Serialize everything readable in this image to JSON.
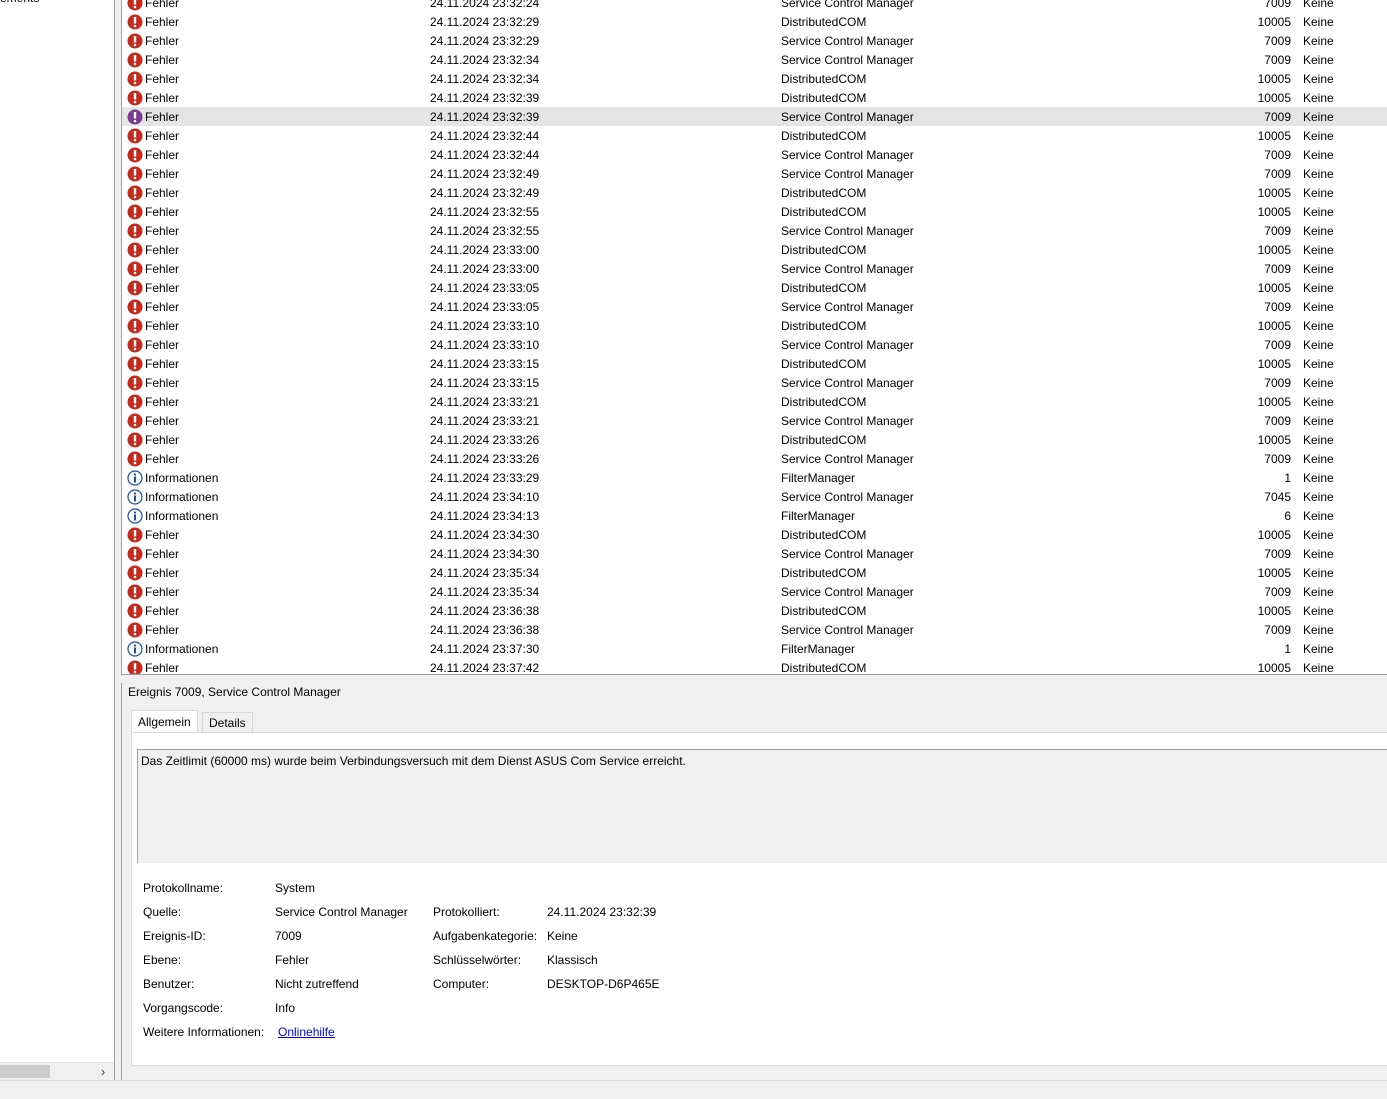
{
  "left_pane": {
    "tree_item_label": "ements"
  },
  "event_list": {
    "rows": [
      {
        "level": "Fehler",
        "type": "error",
        "date": "24.11.2024 23:32:24",
        "source": "Service Control Manager",
        "id": "7009",
        "category": "Keine"
      },
      {
        "level": "Fehler",
        "type": "error",
        "date": "24.11.2024 23:32:29",
        "source": "DistributedCOM",
        "id": "10005",
        "category": "Keine"
      },
      {
        "level": "Fehler",
        "type": "error",
        "date": "24.11.2024 23:32:29",
        "source": "Service Control Manager",
        "id": "7009",
        "category": "Keine"
      },
      {
        "level": "Fehler",
        "type": "error",
        "date": "24.11.2024 23:32:34",
        "source": "Service Control Manager",
        "id": "7009",
        "category": "Keine"
      },
      {
        "level": "Fehler",
        "type": "error",
        "date": "24.11.2024 23:32:34",
        "source": "DistributedCOM",
        "id": "10005",
        "category": "Keine"
      },
      {
        "level": "Fehler",
        "type": "error",
        "date": "24.11.2024 23:32:39",
        "source": "DistributedCOM",
        "id": "10005",
        "category": "Keine"
      },
      {
        "level": "Fehler",
        "type": "error",
        "date": "24.11.2024 23:32:39",
        "source": "Service Control Manager",
        "id": "7009",
        "category": "Keine",
        "selected": true
      },
      {
        "level": "Fehler",
        "type": "error",
        "date": "24.11.2024 23:32:44",
        "source": "DistributedCOM",
        "id": "10005",
        "category": "Keine"
      },
      {
        "level": "Fehler",
        "type": "error",
        "date": "24.11.2024 23:32:44",
        "source": "Service Control Manager",
        "id": "7009",
        "category": "Keine"
      },
      {
        "level": "Fehler",
        "type": "error",
        "date": "24.11.2024 23:32:49",
        "source": "Service Control Manager",
        "id": "7009",
        "category": "Keine"
      },
      {
        "level": "Fehler",
        "type": "error",
        "date": "24.11.2024 23:32:49",
        "source": "DistributedCOM",
        "id": "10005",
        "category": "Keine"
      },
      {
        "level": "Fehler",
        "type": "error",
        "date": "24.11.2024 23:32:55",
        "source": "DistributedCOM",
        "id": "10005",
        "category": "Keine"
      },
      {
        "level": "Fehler",
        "type": "error",
        "date": "24.11.2024 23:32:55",
        "source": "Service Control Manager",
        "id": "7009",
        "category": "Keine"
      },
      {
        "level": "Fehler",
        "type": "error",
        "date": "24.11.2024 23:33:00",
        "source": "DistributedCOM",
        "id": "10005",
        "category": "Keine"
      },
      {
        "level": "Fehler",
        "type": "error",
        "date": "24.11.2024 23:33:00",
        "source": "Service Control Manager",
        "id": "7009",
        "category": "Keine"
      },
      {
        "level": "Fehler",
        "type": "error",
        "date": "24.11.2024 23:33:05",
        "source": "DistributedCOM",
        "id": "10005",
        "category": "Keine"
      },
      {
        "level": "Fehler",
        "type": "error",
        "date": "24.11.2024 23:33:05",
        "source": "Service Control Manager",
        "id": "7009",
        "category": "Keine"
      },
      {
        "level": "Fehler",
        "type": "error",
        "date": "24.11.2024 23:33:10",
        "source": "DistributedCOM",
        "id": "10005",
        "category": "Keine"
      },
      {
        "level": "Fehler",
        "type": "error",
        "date": "24.11.2024 23:33:10",
        "source": "Service Control Manager",
        "id": "7009",
        "category": "Keine"
      },
      {
        "level": "Fehler",
        "type": "error",
        "date": "24.11.2024 23:33:15",
        "source": "DistributedCOM",
        "id": "10005",
        "category": "Keine"
      },
      {
        "level": "Fehler",
        "type": "error",
        "date": "24.11.2024 23:33:15",
        "source": "Service Control Manager",
        "id": "7009",
        "category": "Keine"
      },
      {
        "level": "Fehler",
        "type": "error",
        "date": "24.11.2024 23:33:21",
        "source": "DistributedCOM",
        "id": "10005",
        "category": "Keine"
      },
      {
        "level": "Fehler",
        "type": "error",
        "date": "24.11.2024 23:33:21",
        "source": "Service Control Manager",
        "id": "7009",
        "category": "Keine"
      },
      {
        "level": "Fehler",
        "type": "error",
        "date": "24.11.2024 23:33:26",
        "source": "DistributedCOM",
        "id": "10005",
        "category": "Keine"
      },
      {
        "level": "Fehler",
        "type": "error",
        "date": "24.11.2024 23:33:26",
        "source": "Service Control Manager",
        "id": "7009",
        "category": "Keine"
      },
      {
        "level": "Informationen",
        "type": "info",
        "date": "24.11.2024 23:33:29",
        "source": "FilterManager",
        "id": "1",
        "category": "Keine"
      },
      {
        "level": "Informationen",
        "type": "info",
        "date": "24.11.2024 23:34:10",
        "source": "Service Control Manager",
        "id": "7045",
        "category": "Keine"
      },
      {
        "level": "Informationen",
        "type": "info",
        "date": "24.11.2024 23:34:13",
        "source": "FilterManager",
        "id": "6",
        "category": "Keine"
      },
      {
        "level": "Fehler",
        "type": "error",
        "date": "24.11.2024 23:34:30",
        "source": "DistributedCOM",
        "id": "10005",
        "category": "Keine"
      },
      {
        "level": "Fehler",
        "type": "error",
        "date": "24.11.2024 23:34:30",
        "source": "Service Control Manager",
        "id": "7009",
        "category": "Keine"
      },
      {
        "level": "Fehler",
        "type": "error",
        "date": "24.11.2024 23:35:34",
        "source": "DistributedCOM",
        "id": "10005",
        "category": "Keine"
      },
      {
        "level": "Fehler",
        "type": "error",
        "date": "24.11.2024 23:35:34",
        "source": "Service Control Manager",
        "id": "7009",
        "category": "Keine"
      },
      {
        "level": "Fehler",
        "type": "error",
        "date": "24.11.2024 23:36:38",
        "source": "DistributedCOM",
        "id": "10005",
        "category": "Keine"
      },
      {
        "level": "Fehler",
        "type": "error",
        "date": "24.11.2024 23:36:38",
        "source": "Service Control Manager",
        "id": "7009",
        "category": "Keine"
      },
      {
        "level": "Informationen",
        "type": "info",
        "date": "24.11.2024 23:37:30",
        "source": "FilterManager",
        "id": "1",
        "category": "Keine"
      },
      {
        "level": "Fehler",
        "type": "error",
        "date": "24.11.2024 23:37:42",
        "source": "DistributedCOM",
        "id": "10005",
        "category": "Keine"
      }
    ]
  },
  "detail": {
    "title": "Ereignis 7009, Service Control Manager",
    "tabs": {
      "general": "Allgemein",
      "details": "Details"
    },
    "description": "Das Zeitlimit (60000 ms) wurde beim Verbindungsversuch mit dem Dienst ASUS Com Service erreicht.",
    "labels": {
      "log_name": "Protokollname:",
      "source": "Quelle:",
      "event_id": "Ereignis-ID:",
      "level": "Ebene:",
      "user": "Benutzer:",
      "opcode": "Vorgangscode:",
      "more_info": "Weitere Informationen:",
      "logged": "Protokolliert:",
      "task_category": "Aufgabenkategorie:",
      "keywords": "Schlüsselwörter:",
      "computer": "Computer:"
    },
    "values": {
      "log_name": "System",
      "source": "Service Control Manager",
      "event_id": "7009",
      "level": "Fehler",
      "user": "Nicht zutreffend",
      "opcode": "Info",
      "more_info_link": "Onlinehilfe",
      "logged": "24.11.2024 23:32:39",
      "task_category": "Keine",
      "keywords": "Klassisch",
      "computer": "DESKTOP-D6P465E"
    }
  },
  "colors": {
    "error_icon": "#c42b1c",
    "error_icon_selected": "#7a3c8c",
    "info_icon": "#1a4fa3",
    "link": "#0000ee",
    "selected_row": "#e5e5e5"
  },
  "icons": {
    "error": "error-icon",
    "info": "info-icon",
    "scroll_right": "chevron-right-icon"
  }
}
